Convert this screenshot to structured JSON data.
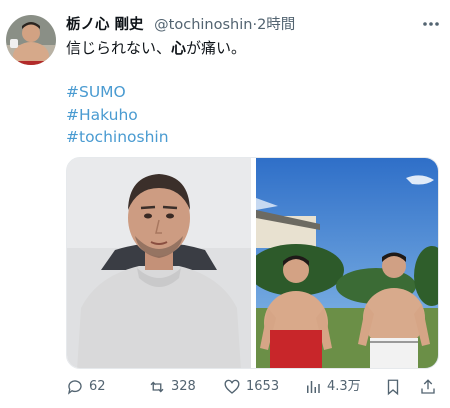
{
  "post": {
    "author_name": "栃ノ心 剛史",
    "handle": "@tochinoshin",
    "separator": "·",
    "time": "2時間",
    "text_before": "信じられない、",
    "text_bold": "心",
    "text_after": "が痛い。",
    "hashtags": [
      "#SUMO",
      "#Hakuho",
      "#tochinoshin"
    ]
  },
  "actions": {
    "replies": "62",
    "reposts": "328",
    "likes": "1653",
    "views": "4.3万"
  },
  "icons": [
    "avatar",
    "more-icon",
    "reply-icon",
    "repost-icon",
    "like-icon",
    "views-icon",
    "bookmark-icon",
    "share-icon"
  ],
  "colors": {
    "hashtag": "#4a9bd1",
    "secondary_text": "#536471",
    "primary_text": "#0f1419"
  }
}
